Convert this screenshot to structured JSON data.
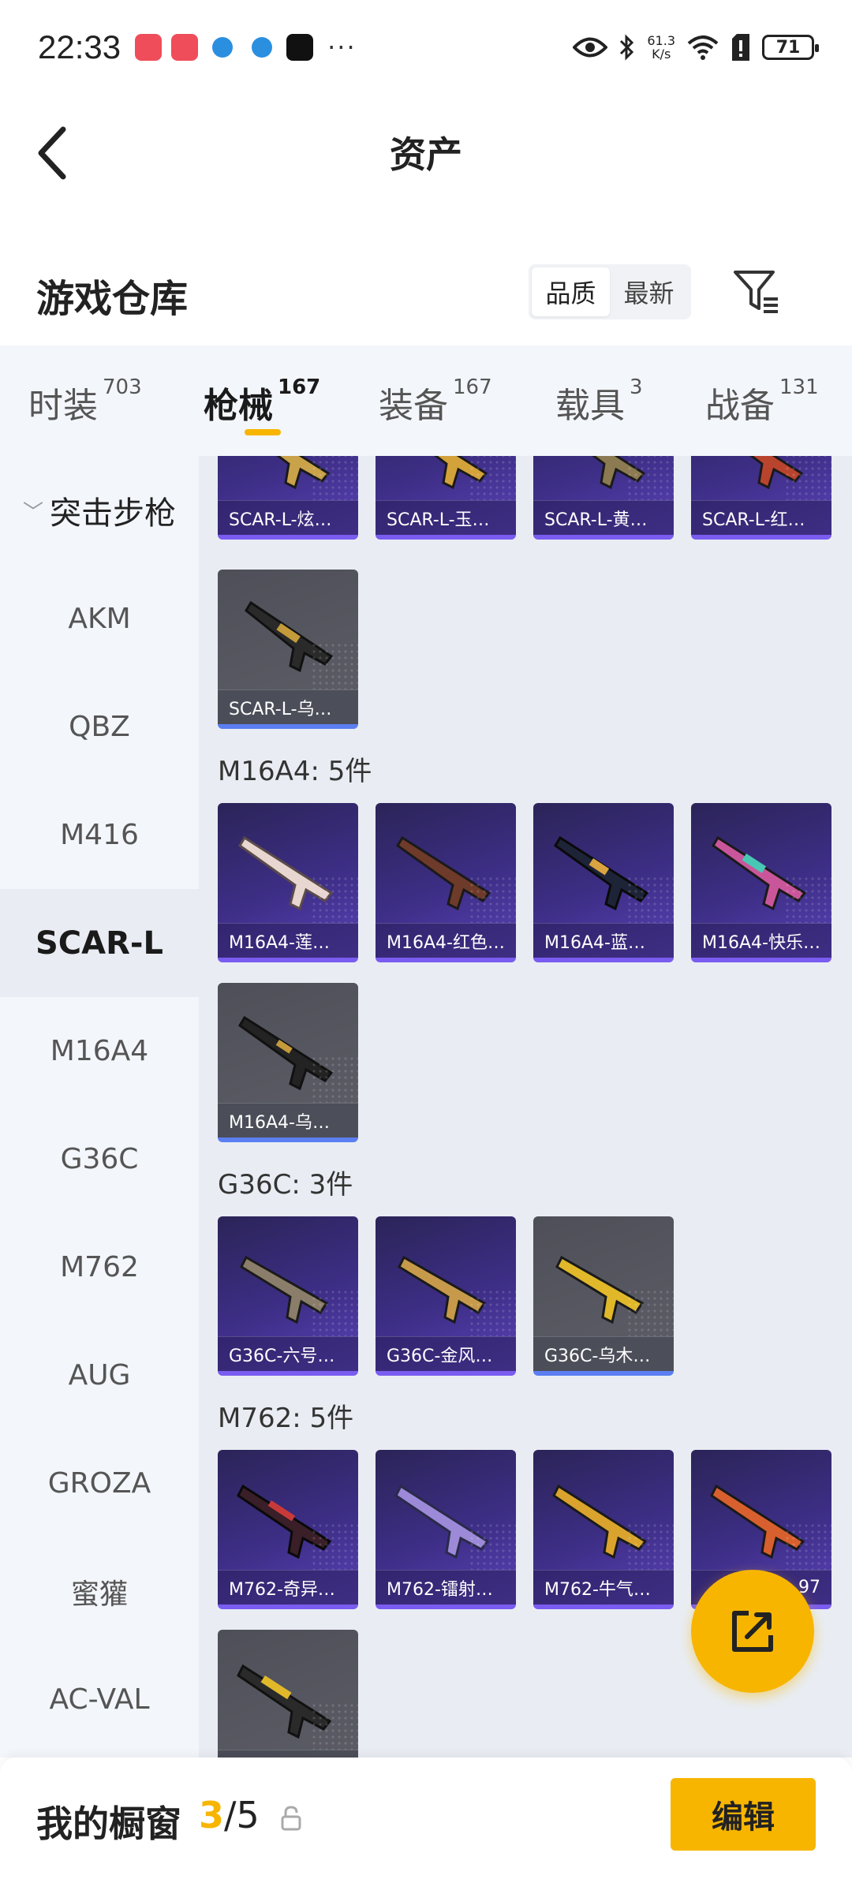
{
  "status_bar": {
    "time": "22:33",
    "net_speed_value": "61.3",
    "net_speed_unit": "K/s",
    "battery": "71",
    "notif_more": "···"
  },
  "header": {
    "title": "资产"
  },
  "warehouse": {
    "title": "游戏仓库",
    "sort_options": [
      "品质",
      "最新"
    ]
  },
  "categories": [
    {
      "label": "时装",
      "count": "703"
    },
    {
      "label": "枪械",
      "count": "167"
    },
    {
      "label": "装备",
      "count": "167"
    },
    {
      "label": "载具",
      "count": "3"
    },
    {
      "label": "战备",
      "count": "131"
    }
  ],
  "sidebar": {
    "group": "突击步枪",
    "items": [
      "AKM",
      "QBZ",
      "M416",
      "SCAR-L",
      "M16A4",
      "G36C",
      "M762",
      "AUG",
      "GROZA",
      "蜜獾",
      "AC-VAL"
    ]
  },
  "content": {
    "scar_cards": [
      "SCAR-L-炫…",
      "SCAR-L-玉…",
      "SCAR-L-黄…",
      "SCAR-L-红…",
      "SCAR-L-乌…"
    ],
    "m16_title": "M16A4: 5件",
    "m16_cards": [
      "M16A4-莲…",
      "M16A4-红色…",
      "M16A4-蓝…",
      "M16A4-快乐…",
      "M16A4-乌…"
    ],
    "g36_title": "G36C: 3件",
    "g36_cards": [
      "G36C-六号…",
      "G36C-金风…",
      "G36C-乌木…"
    ],
    "m762_title": "M762: 5件",
    "m762_cards": [
      "M762-奇异…",
      "M762-镭射…",
      "M762-牛气…",
      "…97",
      ""
    ]
  },
  "bottom": {
    "label": "我的橱窗",
    "current": "3",
    "total": "/5",
    "edit": "编辑"
  },
  "colors": {
    "accent": "#f7b500",
    "card_purple": "#3d2e86",
    "card_gray": "#5d5e67"
  }
}
